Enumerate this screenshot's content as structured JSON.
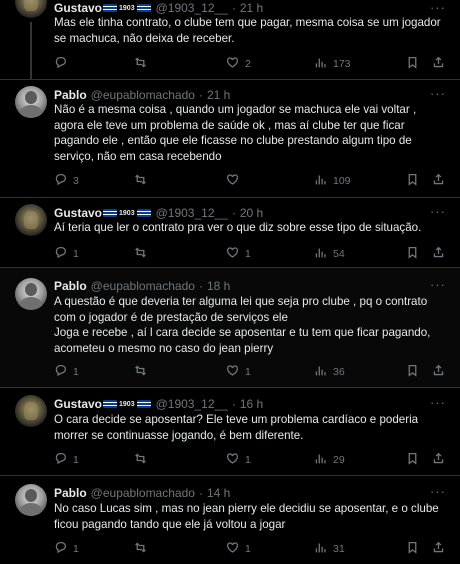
{
  "tweets": [
    {
      "author": "Gustavo",
      "superscript": "1903",
      "handle": "@1903_12__",
      "sep": "·",
      "time": "21 h",
      "text": "Mas ele tinha contrato, o clube tem que pagar, mesma coisa se um jogador se machuca, não deixa de receber.",
      "replies": "",
      "retweets": "",
      "likes": "2",
      "views": "173",
      "avatar": "gustavo"
    },
    {
      "author": "Pablo",
      "superscript": "",
      "handle": "@eupablomachado",
      "sep": "·",
      "time": "21 h",
      "text": "Não é a mesma coisa , quando um jogador se machuca ele vai voltar , agora ele teve um problema de saúde ok , mas aí clube ter que ficar pagando ele , então que ele ficasse no clube prestando algum tipo de serviço, não em casa recebendo",
      "replies": "3",
      "retweets": "",
      "likes": "",
      "views": "109",
      "avatar": "pablo"
    },
    {
      "author": "Gustavo",
      "superscript": "1903",
      "handle": "@1903_12__",
      "sep": "·",
      "time": "20 h",
      "text": "Aí teria que ler o contrato pra ver o que diz sobre esse tipo de situação.",
      "replies": "1",
      "retweets": "",
      "likes": "1",
      "views": "54",
      "avatar": "gustavo"
    },
    {
      "author": "Pablo",
      "superscript": "",
      "handle": "@eupablomachado",
      "sep": "·",
      "time": "18 h",
      "text": "A questão é que deveria ter alguma lei que seja pro clube , pq o contrato com o jogador é de prestação de serviços ele\nJoga e recebe , aí l cara decide se aposentar e tu tem que ficar pagando, acometeu o mesmo no caso do jean pierry",
      "replies": "1",
      "retweets": "",
      "likes": "1",
      "views": "36",
      "avatar": "pablo"
    },
    {
      "author": "Gustavo",
      "superscript": "1903",
      "handle": "@1903_12__",
      "sep": "·",
      "time": "16 h",
      "text": "O cara decide se aposentar? Ele teve um problema cardíaco e poderia morrer se continuasse jogando, é bem diferente.",
      "replies": "1",
      "retweets": "",
      "likes": "1",
      "views": "29",
      "avatar": "gustavo"
    },
    {
      "author": "Pablo",
      "superscript": "",
      "handle": "@eupablomachado",
      "sep": "·",
      "time": "14 h",
      "text": "No caso Lucas sim , mas no jean pierry ele decidiu se aposentar, e o clube ficou pagando tando que ele já voltou a jogar",
      "replies": "1",
      "retweets": "",
      "likes": "1",
      "views": "31",
      "avatar": "pablo"
    }
  ],
  "more_glyph": "···",
  "icons": [
    "reply-icon",
    "retweet-icon",
    "like-icon",
    "views-icon",
    "bookmark-icon",
    "share-icon"
  ]
}
